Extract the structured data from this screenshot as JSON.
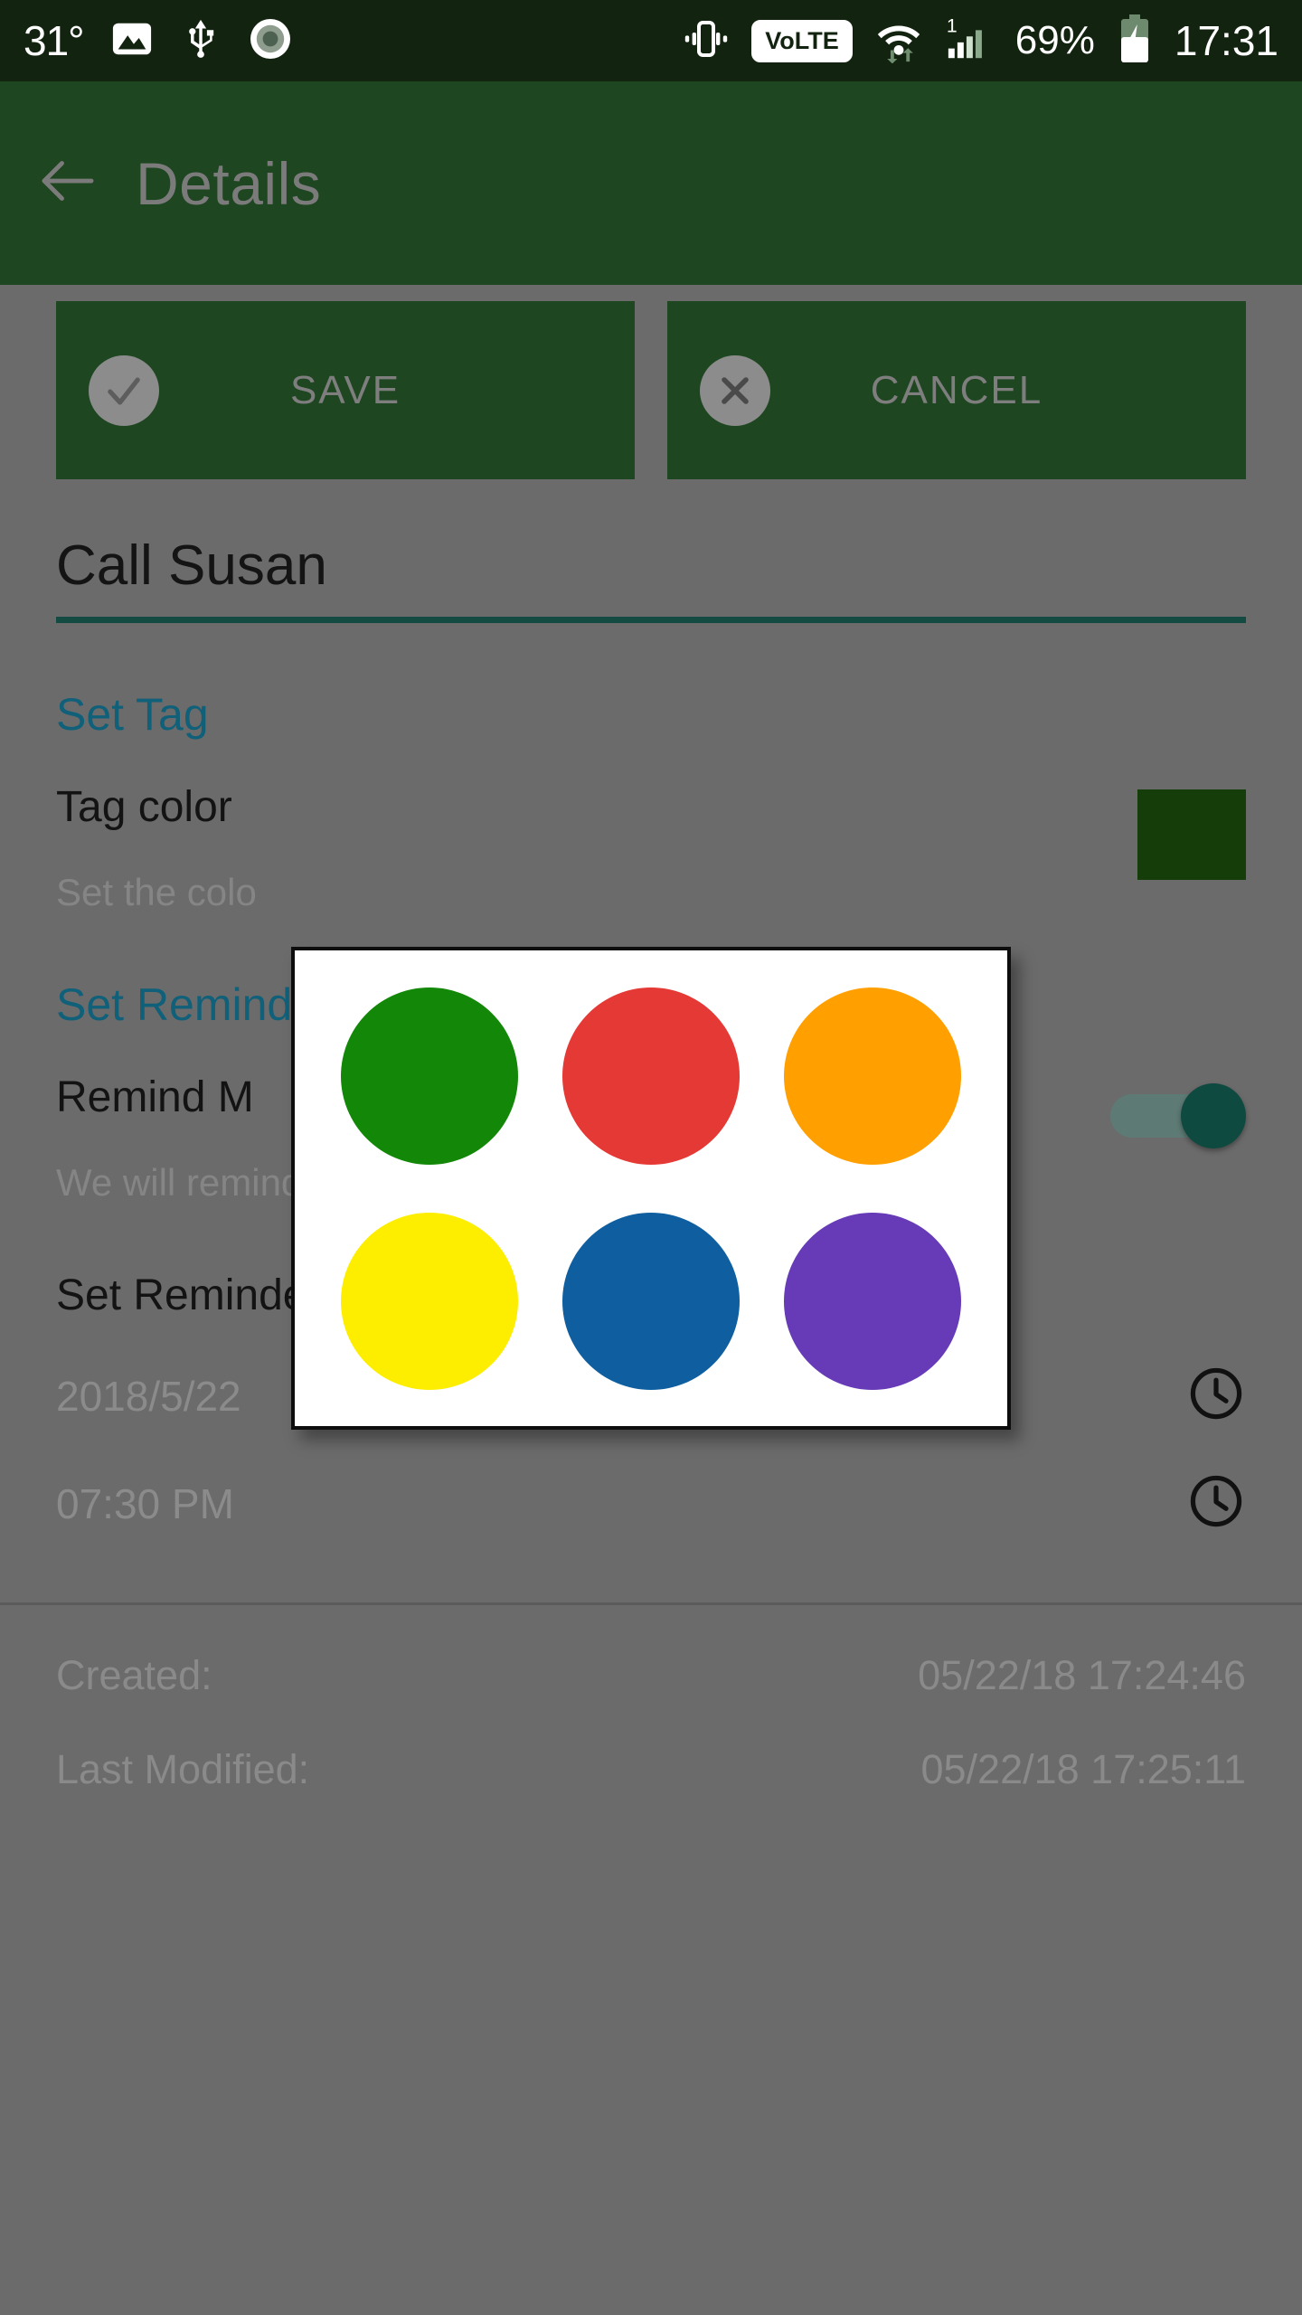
{
  "status_bar": {
    "temperature": "31°",
    "battery_percent": "69%",
    "clock": "17:31",
    "volte_label": "VoLTE",
    "signal_label": "1",
    "icons": [
      "photo-icon",
      "usb-icon",
      "record-icon",
      "vibrate-icon",
      "volte-badge",
      "wifi-icon",
      "cellular-signal-icon",
      "battery-charging-icon"
    ],
    "background": "#12240f"
  },
  "app_bar": {
    "title": "Details",
    "back_icon": "arrow-left-icon",
    "background": "#1e4620",
    "title_color": "#7b7b7b"
  },
  "actions": {
    "save_label": "SAVE",
    "save_icon": "check-circle-icon",
    "cancel_label": "CANCEL",
    "cancel_icon": "close-circle-icon",
    "button_background": "#1e4620",
    "label_color": "#7e7e7e"
  },
  "task": {
    "title_value": "Call Susan",
    "title_underline_color": "#134a42"
  },
  "set_tag": {
    "header": "Set Tag",
    "header_color": "#10607a",
    "tag_color_title": "Tag color",
    "tag_color_subtitle": "Set the colo",
    "tag_color_swatch": "#143d09"
  },
  "set_reminder": {
    "header": "Set Reminder",
    "header_color": "#10607a",
    "remind_me_title": "Remind M",
    "remind_me_subtitle": "We will remind you to do the task",
    "toggle_state": "on",
    "toggle_track_color": "#5e7a74",
    "toggle_thumb_color": "#0f4a41"
  },
  "reminder_time": {
    "label": "Set Reminder Time",
    "date_value": "2018/5/22",
    "date_icon": "clock-icon",
    "time_value": "07:30 PM",
    "time_icon": "clock-icon"
  },
  "meta": {
    "created_key": "Created:",
    "created_value": "05/22/18 17:24:46",
    "modified_key": "Last Modified:",
    "modified_value": "05/22/18 17:25:11"
  },
  "color_dialog": {
    "colors": [
      {
        "name": "green",
        "hex": "#138808"
      },
      {
        "name": "red",
        "hex": "#e53935"
      },
      {
        "name": "orange",
        "hex": "#ffa000"
      },
      {
        "name": "yellow",
        "hex": "#fdee00"
      },
      {
        "name": "blue",
        "hex": "#0f5fa0"
      },
      {
        "name": "purple",
        "hex": "#673ab7"
      }
    ],
    "background": "#ffffff",
    "border_color": "#0d0d0d"
  }
}
